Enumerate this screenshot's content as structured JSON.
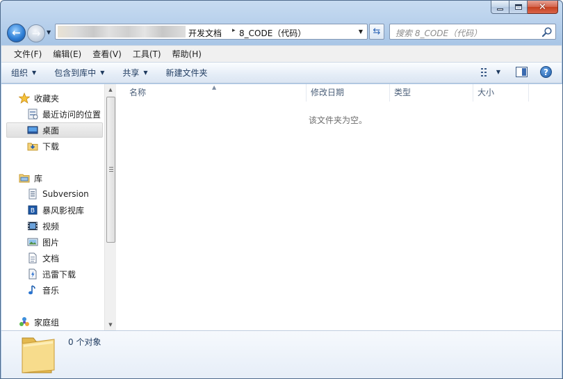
{
  "window": {
    "caption": {
      "minimize": "minimize",
      "maximize": "maximize",
      "close": "✕"
    }
  },
  "address_bar": {
    "crumbs": [
      "开发文档",
      "8_CODE（代码）"
    ],
    "separator": "▸"
  },
  "search": {
    "placeholder": "搜索 8_CODE（代码）"
  },
  "menu": [
    "文件(F)",
    "编辑(E)",
    "查看(V)",
    "工具(T)",
    "帮助(H)"
  ],
  "command_bar": {
    "organize": "组织",
    "include_in_library": "包含到库中",
    "share": "共享",
    "new_folder": "新建文件夹"
  },
  "nav_pane": {
    "favorites": {
      "label": "收藏夹",
      "items": [
        "最近访问的位置",
        "桌面",
        "下载"
      ],
      "selected": "桌面"
    },
    "libraries": {
      "label": "库",
      "items": [
        "Subversion",
        "暴风影视库",
        "视频",
        "图片",
        "文档",
        "迅雷下载",
        "音乐"
      ]
    },
    "homegroup": {
      "label": "家庭组"
    }
  },
  "content": {
    "columns": [
      "名称",
      "修改日期",
      "类型",
      "大小"
    ],
    "empty_message": "该文件夹为空。"
  },
  "details": {
    "object_count": "0 个对象"
  },
  "colors": {
    "window_frame": "#b9d1ec",
    "selection": "#e0e0e0",
    "header_text": "#4c607a",
    "link_text": "#1e3a5f"
  }
}
